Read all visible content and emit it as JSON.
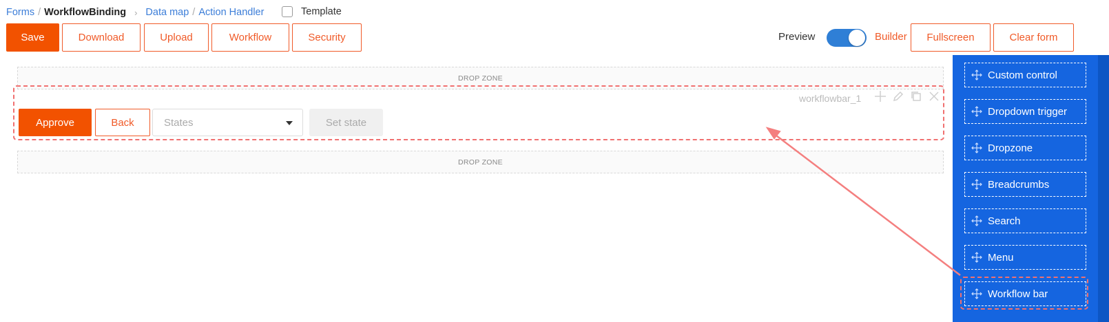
{
  "breadcrumb": {
    "forms": "Forms",
    "sep": "/",
    "current": "WorkflowBinding",
    "chevron": "›",
    "data_map": "Data map",
    "action_handler": "Action Handler"
  },
  "template_label": "Template",
  "toolbar": {
    "save": "Save",
    "download": "Download",
    "upload": "Upload",
    "workflow": "Workflow",
    "security": "Security",
    "preview": "Preview",
    "builder": "Builder",
    "fullscreen": "Fullscreen",
    "clear_form": "Clear form"
  },
  "canvas": {
    "dropzone_label": "DROP ZONE",
    "workflowbar_label": "workflowbar_1",
    "approve": "Approve",
    "back": "Back",
    "states_placeholder": "States",
    "set_state": "Set state"
  },
  "palette": {
    "items": [
      {
        "label": "Custom control",
        "icon": "move-icon"
      },
      {
        "label": "Dropdown trigger",
        "icon": "move-icon"
      },
      {
        "label": "Dropzone",
        "icon": "move-icon"
      },
      {
        "label": "Breadcrumbs",
        "icon": "move-icon"
      },
      {
        "label": "Search",
        "icon": "move-icon"
      },
      {
        "label": "Menu",
        "icon": "move-icon"
      },
      {
        "label": "Workflow bar",
        "icon": "move-icon"
      }
    ]
  },
  "colors": {
    "accent": "#f25200",
    "link": "#3b7dd8",
    "palette_bg": "#1565e0",
    "highlight": "#f07070",
    "toggle": "#2f7fd6"
  }
}
